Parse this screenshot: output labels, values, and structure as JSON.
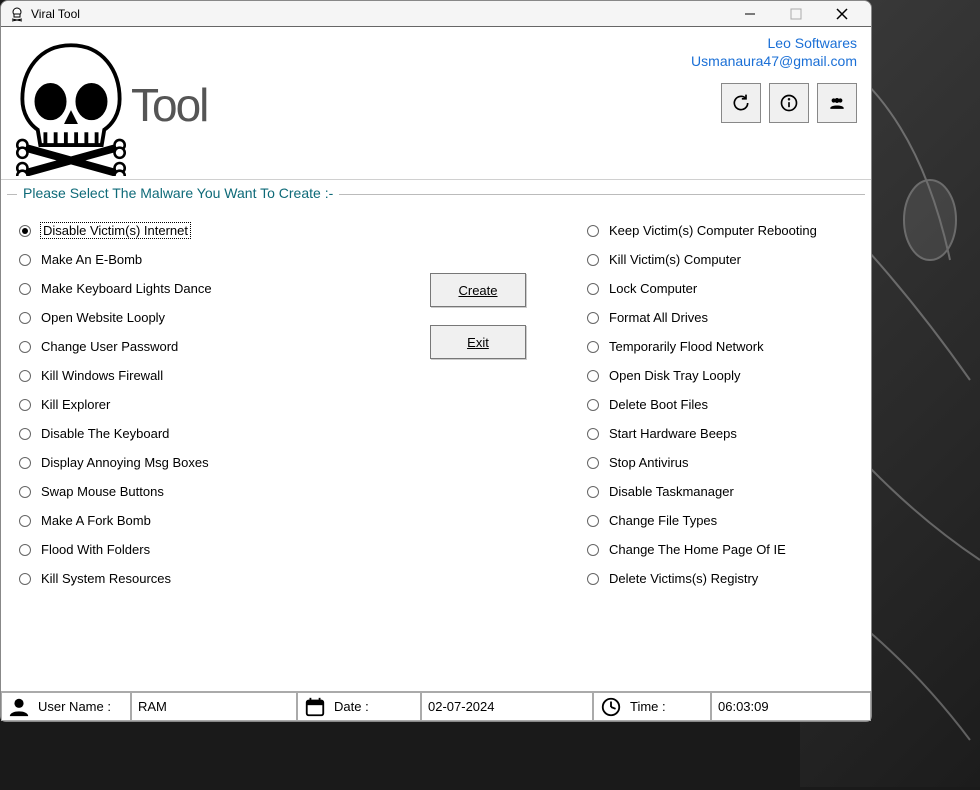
{
  "window": {
    "title": "Viral Tool"
  },
  "header": {
    "logo_text": "Tool",
    "link1": "Leo Softwares",
    "link2": "Usmanaura47@gmail.com"
  },
  "fieldset_legend": "Please Select The Malware You Want To Create :-",
  "left_options": [
    {
      "label": "Disable Victim(s) Internet",
      "checked": true
    },
    {
      "label": "Make An E-Bomb",
      "checked": false
    },
    {
      "label": "Make Keyboard Lights Dance",
      "checked": false
    },
    {
      "label": "Open Website Looply",
      "checked": false
    },
    {
      "label": "Change User Password",
      "checked": false
    },
    {
      "label": "Kill Windows Firewall",
      "checked": false
    },
    {
      "label": "Kill Explorer",
      "checked": false
    },
    {
      "label": "Disable The Keyboard",
      "checked": false
    },
    {
      "label": "Display Annoying Msg Boxes",
      "checked": false
    },
    {
      "label": "Swap Mouse Buttons",
      "checked": false
    },
    {
      "label": "Make A Fork Bomb",
      "checked": false
    },
    {
      "label": "Flood With Folders",
      "checked": false
    },
    {
      "label": "Kill System Resources",
      "checked": false
    }
  ],
  "right_options": [
    {
      "label": "Keep Victim(s) Computer Rebooting",
      "checked": false
    },
    {
      "label": "Kill Victim(s) Computer",
      "checked": false
    },
    {
      "label": "Lock Computer",
      "checked": false
    },
    {
      "label": "Format All Drives",
      "checked": false
    },
    {
      "label": "Temporarily Flood Network",
      "checked": false
    },
    {
      "label": "Open Disk Tray Looply",
      "checked": false
    },
    {
      "label": "Delete Boot Files",
      "checked": false
    },
    {
      "label": "Start Hardware Beeps",
      "checked": false
    },
    {
      "label": "Stop Antivirus",
      "checked": false
    },
    {
      "label": "Disable Taskmanager",
      "checked": false
    },
    {
      "label": "Change File Types",
      "checked": false
    },
    {
      "label": "Change The Home Page Of IE",
      "checked": false
    },
    {
      "label": "Delete Victims(s) Registry",
      "checked": false
    }
  ],
  "buttons": {
    "create": "Create",
    "exit": "Exit"
  },
  "status": {
    "username_label": "User Name :",
    "username_value": "RAM",
    "date_label": "Date :",
    "date_value": "02-07-2024",
    "time_label": "Time :",
    "time_value": "06:03:09"
  }
}
